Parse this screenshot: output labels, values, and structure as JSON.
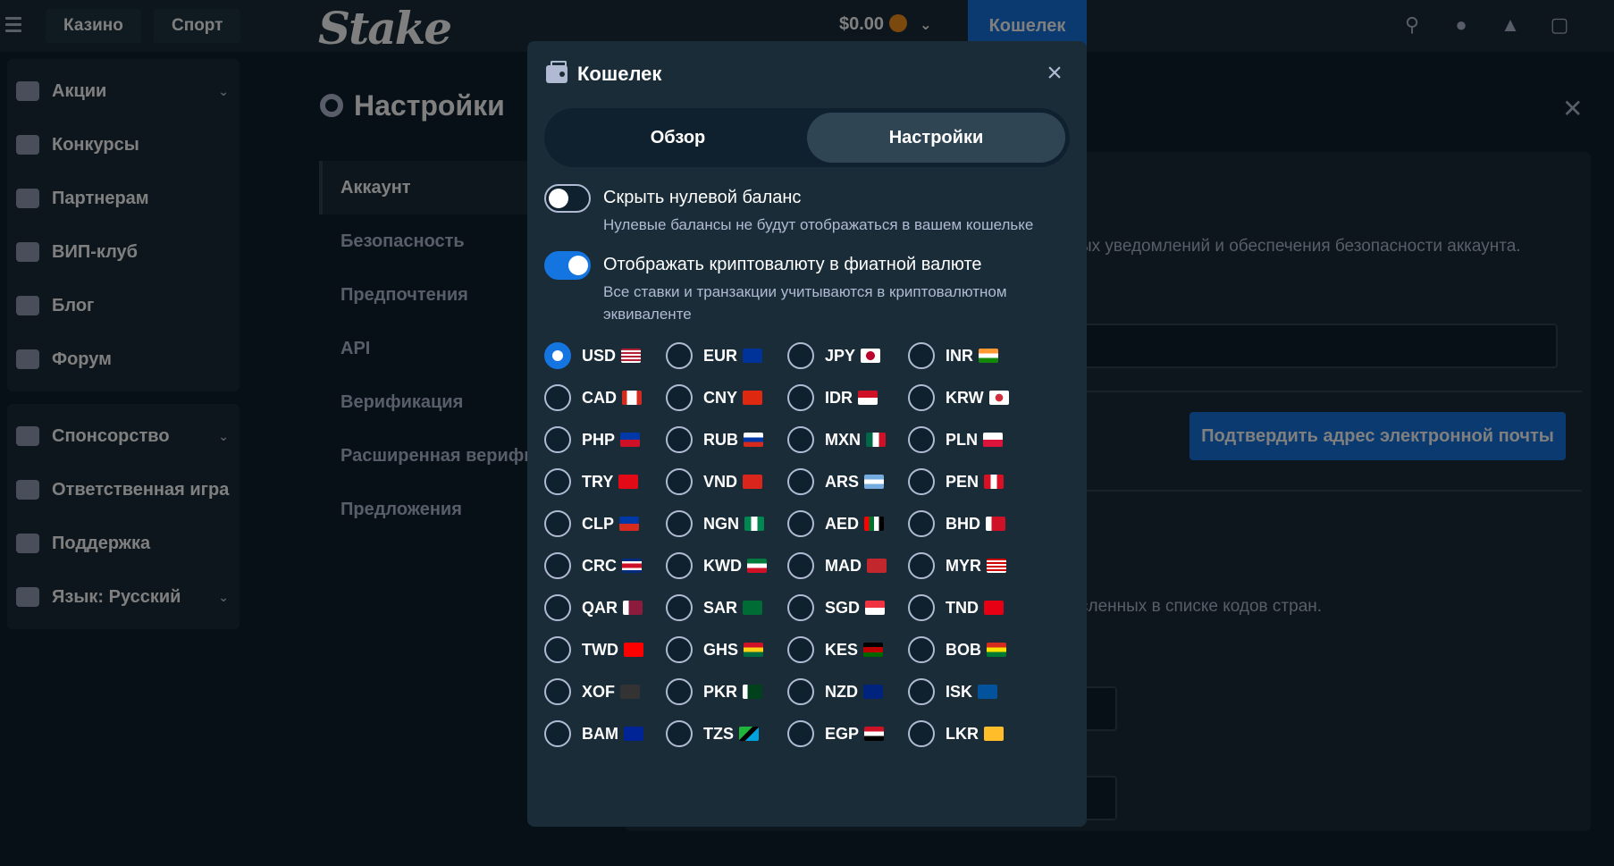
{
  "topbar": {
    "casino_tab": "Казино",
    "sport_tab": "Спорт",
    "logo": "Stake",
    "balance": "$0.00",
    "wallet_button": "Кошелек"
  },
  "sidebar": {
    "items": [
      {
        "label": "Акции",
        "icon": "gift-icon"
      },
      {
        "label": "Конкурсы",
        "icon": "trophy-icon"
      },
      {
        "label": "Партнерам",
        "icon": "users-icon"
      },
      {
        "label": "ВИП-клуб",
        "icon": "vip-trophy-icon"
      },
      {
        "label": "Блог",
        "icon": "blog-icon"
      },
      {
        "label": "Форум",
        "icon": "forum-icon"
      }
    ],
    "items2": [
      {
        "label": "Спонсорство",
        "icon": "sponsor-icon"
      },
      {
        "label": "Ответственная игра",
        "icon": "shield-icon"
      },
      {
        "label": "Поддержка",
        "icon": "headset-icon"
      },
      {
        "label": "Язык: Русский",
        "icon": "globe-icon"
      }
    ]
  },
  "settings": {
    "title": "Настройки",
    "nav": [
      "Аккаунт",
      "Безопасность",
      "Предпочтения",
      "API",
      "Верификация",
      "Расширенная верифи",
      "Предложения"
    ],
    "bg_text_1": "ых уведомлений и обеспечения безопасности аккаунта.",
    "bg_text_2": "сленных в списке кодов стран.",
    "confirm_email_button": "Подтвердить адрес электронной почты"
  },
  "wallet_modal": {
    "title": "Кошелек",
    "tabs": [
      "Обзор",
      "Настройки"
    ],
    "active_tab": "Настройки",
    "hide_zero": {
      "label": "Скрыть нулевой баланс",
      "description": "Нулевые балансы не будут отображаться в вашем кошельке",
      "enabled": false
    },
    "display_fiat": {
      "label": "Отображать криптовалюту в фиатной валюте",
      "description": "Все ставки и транзакции учитываются в криптовалютном эквиваленте",
      "enabled": true
    },
    "selected_currency": "USD",
    "currencies": [
      "USD",
      "EUR",
      "JPY",
      "INR",
      "CAD",
      "CNY",
      "IDR",
      "KRW",
      "PHP",
      "RUB",
      "MXN",
      "PLN",
      "TRY",
      "VND",
      "ARS",
      "PEN",
      "CLP",
      "NGN",
      "AED",
      "BHD",
      "CRC",
      "KWD",
      "MAD",
      "MYR",
      "QAR",
      "SAR",
      "SGD",
      "TND",
      "TWD",
      "GHS",
      "KES",
      "BOB",
      "XOF",
      "PKR",
      "NZD",
      "ISK",
      "BAM",
      "TZS",
      "EGP",
      "LKR"
    ]
  },
  "colors": {
    "background": "#0f212e",
    "panel": "#1a2c38",
    "accent_blue": "#1475e1",
    "muted_text": "#b1bad3"
  }
}
